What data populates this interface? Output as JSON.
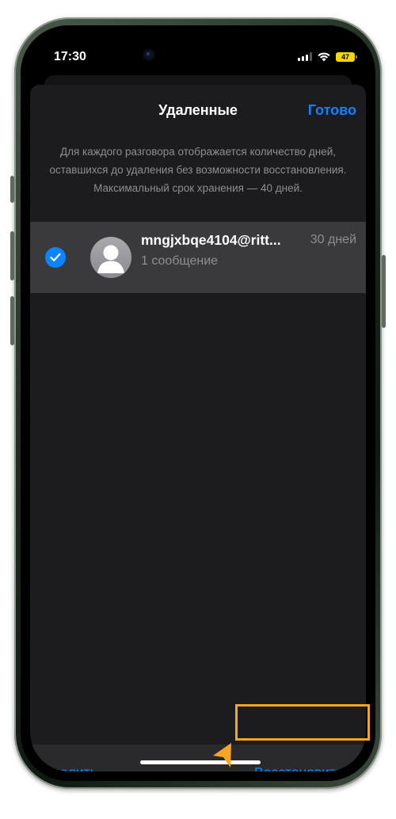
{
  "status_bar": {
    "time": "17:30",
    "battery_level": "47",
    "signal_bars": 3,
    "signal_bars_total": 4,
    "wifi": true,
    "battery_color": "#f5d800"
  },
  "sheet": {
    "title": "Удаленные",
    "done_label": "Готово",
    "info": "Для каждого разговора отображается количество дней, оставшихся до удаления без возможности восстановления. Максимальный срок хранения — 40 дней."
  },
  "conversations": [
    {
      "name": "mngjxbqe4104@ritt...",
      "days_left": "30 дней",
      "message_count": "1 сообщение",
      "selected": true
    }
  ],
  "toolbar": {
    "delete_label": "Удалить",
    "restore_label": "Восстановить"
  },
  "colors": {
    "accent": "#0a84ff",
    "background": "#1c1c1e",
    "selected_row": "#3a3a3c",
    "secondary_text": "#8e8e93",
    "highlight": "#f5a623"
  },
  "icons": {
    "check": "checkmark-circle-icon",
    "avatar": "person-silhouette-icon",
    "wifi": "wifi-icon",
    "signal": "cellular-signal-icon",
    "battery": "battery-icon",
    "pointer": "arrow-pointer-icon"
  }
}
